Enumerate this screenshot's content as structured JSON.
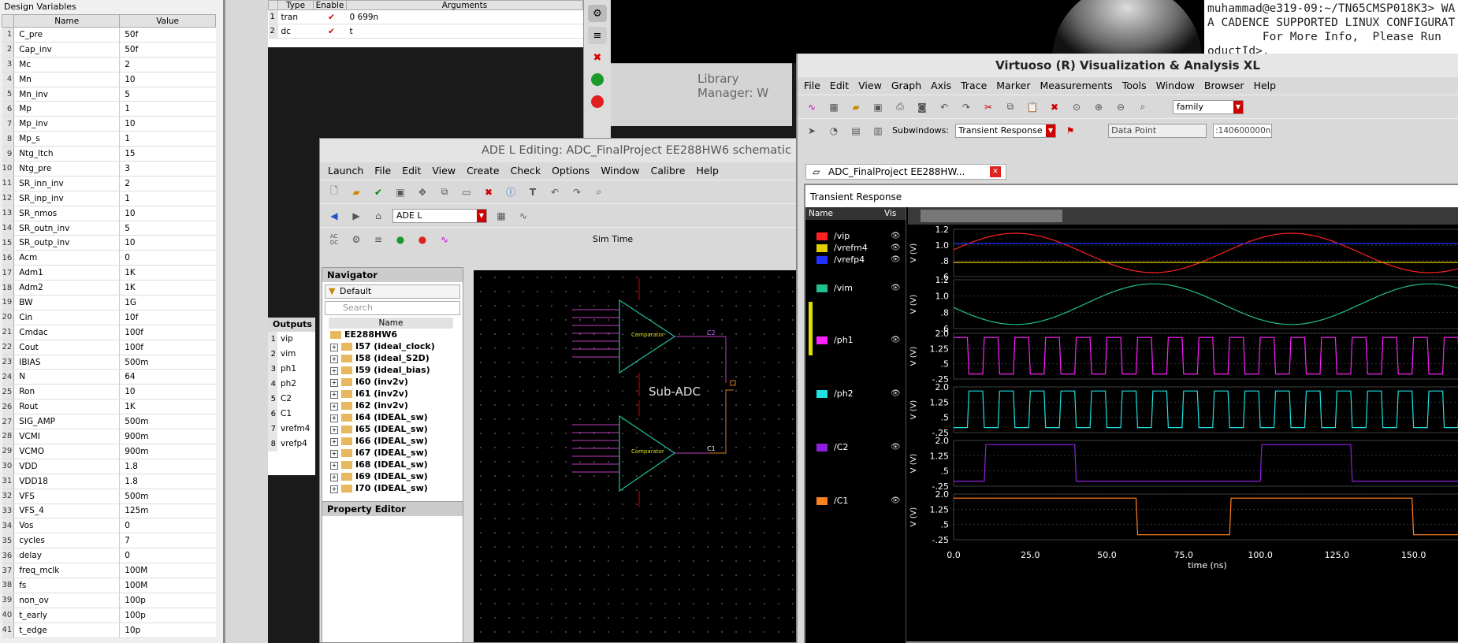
{
  "design_variables": {
    "title": "Design Variables",
    "col_name": "Name",
    "col_value": "Value",
    "rows": [
      [
        "C_pre",
        "50f"
      ],
      [
        "Cap_inv",
        "50f"
      ],
      [
        "Mc",
        "2"
      ],
      [
        "Mn",
        "10"
      ],
      [
        "Mn_inv",
        "5"
      ],
      [
        "Mp",
        "1"
      ],
      [
        "Mp_inv",
        "10"
      ],
      [
        "Mp_s",
        "1"
      ],
      [
        "Ntg_ltch",
        "15"
      ],
      [
        "Ntg_pre",
        "3"
      ],
      [
        "SR_inn_inv",
        "2"
      ],
      [
        "SR_inp_inv",
        "1"
      ],
      [
        "SR_nmos",
        "10"
      ],
      [
        "SR_outn_inv",
        "5"
      ],
      [
        "SR_outp_inv",
        "10"
      ],
      [
        "Acm",
        "0"
      ],
      [
        "Adm1",
        "1K"
      ],
      [
        "Adm2",
        "1K"
      ],
      [
        "BW",
        "1G"
      ],
      [
        "Cin",
        "10f"
      ],
      [
        "Cmdac",
        "100f"
      ],
      [
        "Cout",
        "100f"
      ],
      [
        "IBIAS",
        "500m"
      ],
      [
        "N",
        "64"
      ],
      [
        "Ron",
        "10"
      ],
      [
        "Rout",
        "1K"
      ],
      [
        "SIG_AMP",
        "500m"
      ],
      [
        "VCMI",
        "900m"
      ],
      [
        "VCMO",
        "900m"
      ],
      [
        "VDD",
        "1.8"
      ],
      [
        "VDD18",
        "1.8"
      ],
      [
        "VFS",
        "500m"
      ],
      [
        "VFS_4",
        "125m"
      ],
      [
        "Vos",
        "0"
      ],
      [
        "cycles",
        "7"
      ],
      [
        "delay",
        "0"
      ],
      [
        "freq_mclk",
        "100M"
      ],
      [
        "fs",
        "100M"
      ],
      [
        "non_ov",
        "100p"
      ],
      [
        "t_early",
        "100p"
      ],
      [
        "t_edge",
        "10p"
      ]
    ]
  },
  "analyses": {
    "col_type": "Type",
    "col_enable": "Enable",
    "col_args": "Arguments",
    "rows": [
      {
        "n": "1",
        "type": "tran",
        "args": "0 699n"
      },
      {
        "n": "2",
        "type": "dc",
        "args": "t"
      }
    ]
  },
  "outputs": {
    "title": "Outputs",
    "rows": [
      "vip",
      "vim",
      "ph1",
      "ph2",
      "C2",
      "C1",
      "vrefm4",
      "vrefp4"
    ]
  },
  "terminal": {
    "lines": [
      "muhammad@e319-09:~/TN65CMSP018K3> WA",
      "A CADENCE SUPPORTED LINUX CONFIGURAT",
      "        For More Info,  Please Run",
      "oductId>."
    ]
  },
  "library_manager": {
    "title": "Library Manager: W"
  },
  "ade": {
    "title": "ADE L Editing: ADC_FinalProject EE288HW6 schematic",
    "menu": [
      "Launch",
      "File",
      "Edit",
      "View",
      "Create",
      "Check",
      "Options",
      "Window",
      "Calibre",
      "Help"
    ],
    "mode_select": "ADE L",
    "sim_time": "Sim Time",
    "navigator": {
      "title": "Navigator",
      "filter": "Default",
      "search_placeholder": "Search",
      "col": "Name",
      "root": "EE288HW6",
      "items": [
        "I57 (ideal_clock)",
        "I58 (ideal_S2D)",
        "I59 (ideal_bias)",
        "I60 (inv2v)",
        "I61 (inv2v)",
        "I62 (inv2v)",
        "I64 (IDEAL_sw)",
        "I65 (IDEAL_sw)",
        "I66 (IDEAL_sw)",
        "I67 (IDEAL_sw)",
        "I68 (IDEAL_sw)",
        "I69 (IDEAL_sw)",
        "I70 (IDEAL_sw)"
      ]
    },
    "property_editor": {
      "title": "Property Editor"
    },
    "schematic": {
      "label": "Sub-ADC",
      "comparator": "Comparator",
      "net_c2": "C2",
      "net_c1": "C1"
    }
  },
  "viz": {
    "title": "Virtuoso (R) Visualization & Analysis XL",
    "menu": [
      "File",
      "Edit",
      "View",
      "Graph",
      "Axis",
      "Trace",
      "Marker",
      "Measurements",
      "Tools",
      "Window",
      "Browser",
      "Help"
    ],
    "family_select": "family",
    "subwindows_label": "Subwindows:",
    "subwindow_value": "Transient Response",
    "data_point": "Data Point",
    "data_value": ":140600000n",
    "tab": "ADC_FinalProject EE288HW...",
    "panel_title": "Transient Response",
    "col_name": "Name",
    "col_vis": "Vis",
    "signals": [
      {
        "name": "/vip",
        "color": "#ff2020"
      },
      {
        "name": "/vrefm4",
        "color": "#e0d000"
      },
      {
        "name": "/vrefp4",
        "color": "#2030ff"
      },
      {
        "name": "/vim",
        "color": "#20c090"
      },
      {
        "name": "/ph1",
        "color": "#ff20ff"
      },
      {
        "name": "/ph2",
        "color": "#20e0e0"
      },
      {
        "name": "/C2",
        "color": "#9020e0"
      },
      {
        "name": "/C1",
        "color": "#ff8020"
      }
    ],
    "ylabel": "V (V)",
    "yticks_1": [
      "1.2",
      "1.0",
      ".8",
      ".6"
    ],
    "yticks_2": [
      "1.2",
      "1.0",
      ".8",
      ".6"
    ],
    "yticks_dig": [
      "2.0",
      "1.25",
      ".5",
      "-.25"
    ],
    "xlabel": "time (ns)",
    "xticks": [
      "0.0",
      "25.0",
      "50.0",
      "75.0",
      "100.0",
      "125.0",
      "150.0"
    ]
  }
}
